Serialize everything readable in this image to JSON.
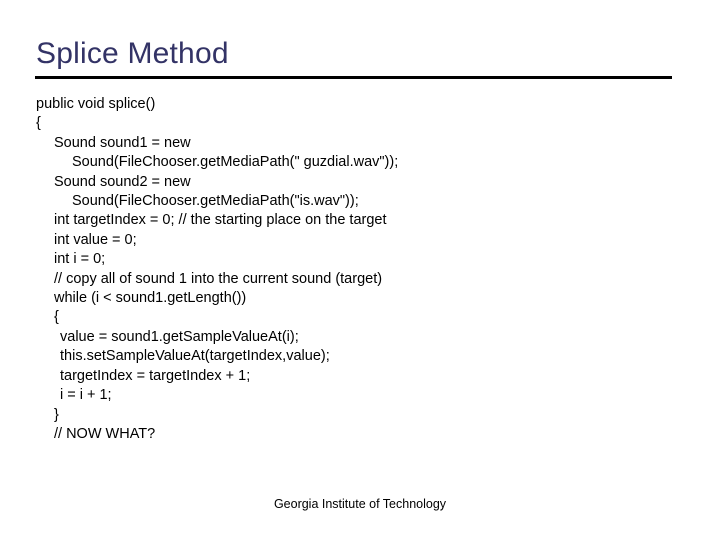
{
  "slide": {
    "title": "Splice Method",
    "rule_color": "#000000",
    "title_color": "#333366",
    "background_color": "#ffffff"
  },
  "code": {
    "lines": [
      {
        "text": "public void splice()",
        "indent": 0
      },
      {
        "text": "{",
        "indent": 0
      },
      {
        "text": "Sound sound1 = new",
        "indent": 1
      },
      {
        "text": "Sound(FileChooser.getMediaPath(\" guzdial.wav\"));",
        "indent": 2
      },
      {
        "text": "Sound sound2 = new",
        "indent": 1
      },
      {
        "text": "Sound(FileChooser.getMediaPath(\"is.wav\"));",
        "indent": 2
      },
      {
        "text": "int targetIndex = 0; // the starting place on the target",
        "indent": 1
      },
      {
        "text": "int value = 0;",
        "indent": 1
      },
      {
        "text": "int i = 0;",
        "indent": 1
      },
      {
        "text": "// copy all of sound 1 into the current sound (target)",
        "indent": 1
      },
      {
        "text": "while (i < sound1.getLength())",
        "indent": 1
      },
      {
        "text": "{",
        "indent": 1
      },
      {
        "text": "value = sound1.getSampleValueAt(i);",
        "indent": 3
      },
      {
        "text": "this.setSampleValueAt(targetIndex,value);",
        "indent": 3
      },
      {
        "text": "targetIndex = targetIndex + 1;",
        "indent": 3
      },
      {
        "text": "i = i + 1;",
        "indent": 3
      },
      {
        "text": "}",
        "indent": 1
      },
      {
        "text": "// NOW WHAT?",
        "indent": 1
      }
    ]
  },
  "footer": {
    "text": "Georgia Institute of Technology"
  }
}
